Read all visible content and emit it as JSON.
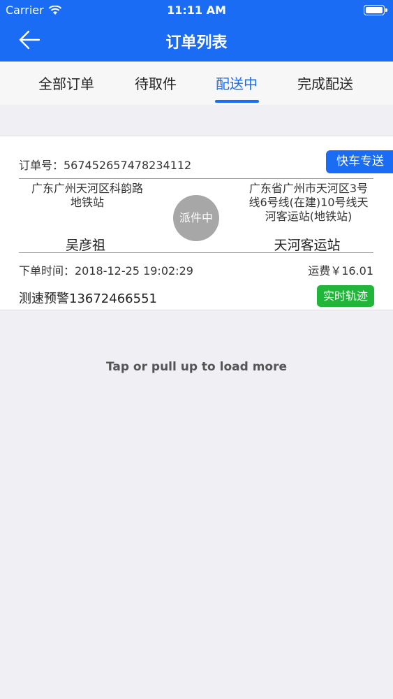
{
  "status_bar": {
    "carrier": "Carrier",
    "time": "11:11 AM"
  },
  "nav": {
    "title": "订单列表",
    "back_icon": "arrow-left-icon"
  },
  "tabs": [
    {
      "label": "全部订单",
      "active": false
    },
    {
      "label": "待取件",
      "active": false
    },
    {
      "label": "配送中",
      "active": true
    },
    {
      "label": "完成配送",
      "active": false
    }
  ],
  "order": {
    "order_no_label": "订单号：567452657478234112",
    "type_badge": "快车专送",
    "from_address": "广东广州天河区科韵路地铁站",
    "to_address": "广东省广州市天河区3号线6号线(在建)10号线天河客运站(地铁站)",
    "status": "派件中",
    "sender_name": "吴彦祖",
    "receiver_name": "天河客运站",
    "order_time": "下单时间：2018-12-25 19:02:29",
    "fee": "运费￥16.01",
    "alert_phone": "测速预警13672466551",
    "track_button": "实时轨迹"
  },
  "load_more": "Tap or pull up to load more",
  "colors": {
    "primary": "#1a6cf5",
    "success": "#21b53a",
    "status_gray": "#a7a7a7"
  }
}
